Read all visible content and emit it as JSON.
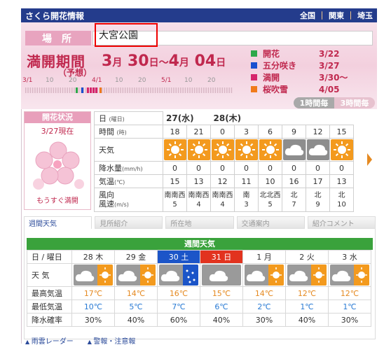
{
  "header": {
    "title": "さくら開花情報",
    "regions": [
      "全国",
      "関東",
      "埼玉"
    ],
    "separator": "｜"
  },
  "place": {
    "label": "場所",
    "name": "大宮公園"
  },
  "bloom": {
    "title": "満開期間",
    "subtitle": "（予想）",
    "start_month": "3",
    "start_day": "30",
    "end_month": "4",
    "end_day": "04",
    "month_unit": "月",
    "day_unit": "日",
    "range_sep": "〜"
  },
  "timeline": {
    "ticks": [
      {
        "label": "3/1",
        "month": true
      },
      {
        "label": "10",
        "month": false
      },
      {
        "label": "20",
        "month": false
      },
      {
        "label": "4/1",
        "month": true
      },
      {
        "label": "10",
        "month": false
      },
      {
        "label": "20",
        "month": false
      },
      {
        "label": "5/1",
        "month": true
      },
      {
        "label": "10",
        "month": false
      },
      {
        "label": "20",
        "month": false
      }
    ]
  },
  "legend": [
    {
      "name": "開花",
      "date": "3/22",
      "color": "#2ea84b"
    },
    {
      "name": "五分咲き",
      "date": "3/27",
      "color": "#1a4fd0"
    },
    {
      "name": "満開",
      "date": "3/30〜",
      "color": "#d6246b"
    },
    {
      "name": "桜吹雪",
      "date": "4/05",
      "color": "#f07a1a"
    }
  ],
  "hour_buttons": [
    "1時間毎",
    "3時間毎"
  ],
  "status": {
    "header": "開花状況",
    "date": "3/27現在",
    "footer": "もうすぐ満開"
  },
  "hourly": {
    "labels": {
      "day": "日",
      "day_unit": "(曜日)",
      "time": "時間",
      "time_unit": "(時)",
      "weather": "天気",
      "precip": "降水量",
      "precip_unit": "(mm/h)",
      "temp": "気温",
      "temp_unit": "(℃)",
      "wind_dir": "風向",
      "wind_speed": "風速",
      "wind_unit": "(m/s)"
    },
    "days": [
      "27(水)",
      "28(木)"
    ],
    "times": [
      "18",
      "21",
      "0",
      "3",
      "6",
      "9",
      "12",
      "15"
    ],
    "weather": [
      "sun",
      "sun",
      "sun",
      "sun",
      "sun",
      "cloud",
      "cloud",
      "sun"
    ],
    "precip": [
      "0",
      "0",
      "0",
      "0",
      "0",
      "0",
      "0",
      "0"
    ],
    "temp": [
      "15",
      "13",
      "12",
      "11",
      "10",
      "16",
      "17",
      "13"
    ],
    "wind_dir": [
      "南南西",
      "南南西",
      "南南西",
      "南",
      "北北西",
      "北",
      "北",
      "北"
    ],
    "wind_speed": [
      "5",
      "4",
      "4",
      "3",
      "5",
      "7",
      "9",
      "10"
    ]
  },
  "tabs": [
    "週間天気",
    "見所紹介",
    "所在地",
    "交通案内",
    "紹介コメント"
  ],
  "weekly": {
    "title": "週間天気",
    "labels": {
      "date": "日 / 曜日",
      "weather": "天 気",
      "high": "最高気温",
      "low": "最低気温",
      "rain": "降水確率"
    },
    "days": [
      {
        "date": "28 木",
        "type": "normal",
        "weather": "cloud-sun",
        "high": "17℃",
        "low": "10℃",
        "rain": "30%"
      },
      {
        "date": "29 金",
        "type": "normal",
        "weather": "cloud-sun",
        "high": "14℃",
        "low": "5℃",
        "rain": "40%"
      },
      {
        "date": "30 土",
        "type": "sat",
        "weather": "cloud-snow",
        "high": "16℃",
        "low": "7℃",
        "rain": "60%"
      },
      {
        "date": "31 日",
        "type": "hol",
        "weather": "cloud",
        "high": "15℃",
        "low": "6℃",
        "rain": "40%"
      },
      {
        "date": "1 月",
        "type": "normal",
        "weather": "cloud-sun",
        "high": "14℃",
        "low": "2℃",
        "rain": "30%"
      },
      {
        "date": "2 火",
        "type": "normal",
        "weather": "cloud-sun",
        "high": "12℃",
        "low": "1℃",
        "rain": "40%"
      },
      {
        "date": "3 水",
        "type": "normal",
        "weather": "cloud-sun",
        "high": "12℃",
        "low": "1℃",
        "rain": "30%"
      }
    ]
  },
  "footer_links": [
    "雨雲レーダー",
    "警報・注意報"
  ]
}
